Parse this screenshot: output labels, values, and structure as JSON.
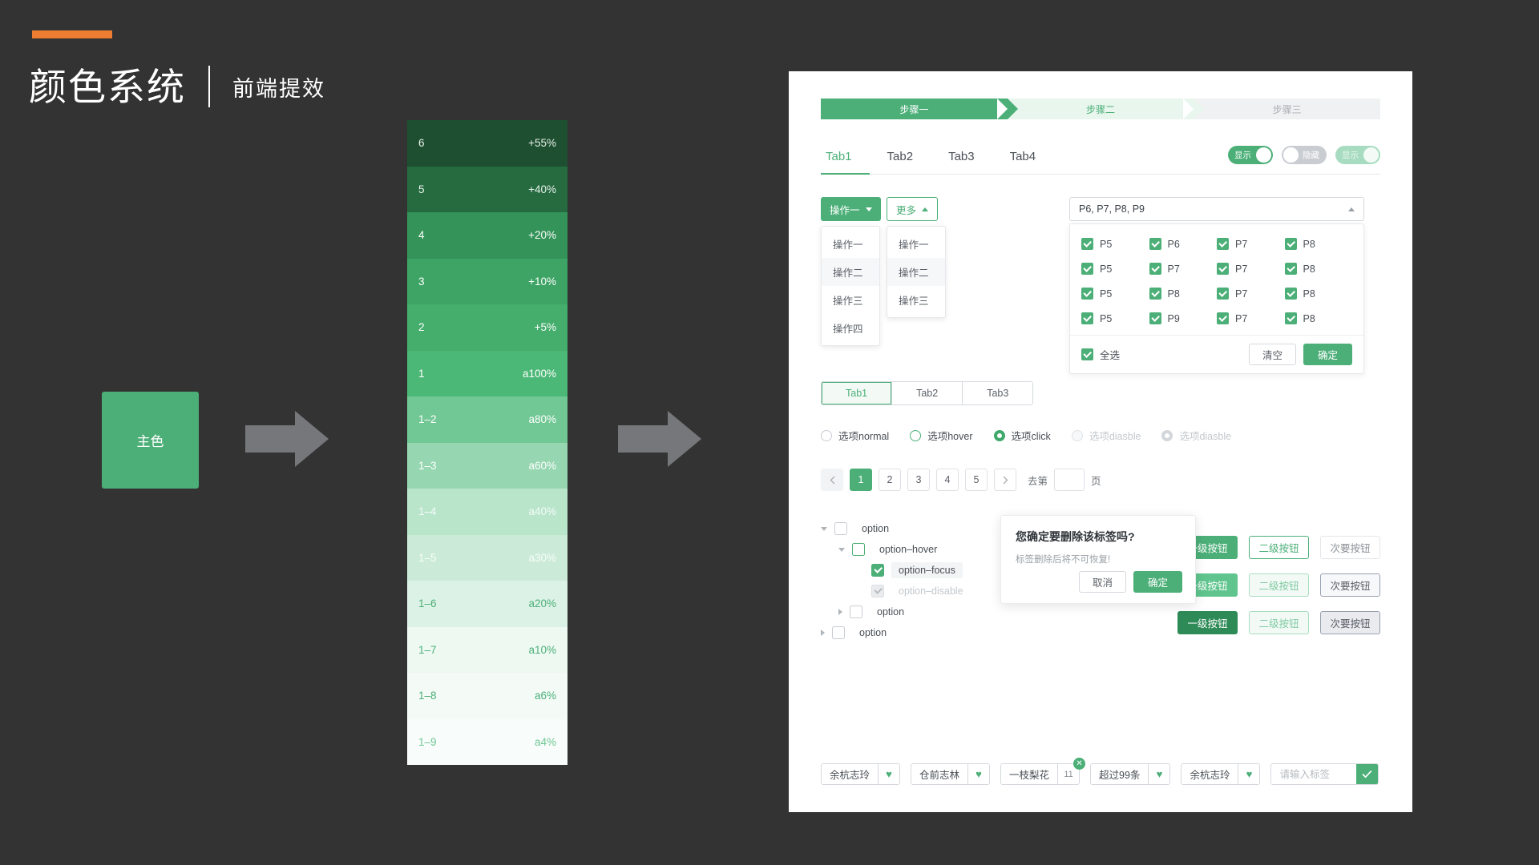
{
  "header": {
    "title": "颜色系统",
    "subtitle": "前端提效",
    "accent_color": "#ED7D31"
  },
  "main_color_block": {
    "label": "主色",
    "color": "#4CAF78"
  },
  "arrows": {
    "color": "#76777A",
    "count": 2
  },
  "palette": [
    {
      "step": "6",
      "value": "+55%",
      "color": "#1D4F30",
      "text": "#E8F0EA"
    },
    {
      "step": "5",
      "value": "+40%",
      "color": "#266B40",
      "text": "#E8F2EC"
    },
    {
      "step": "4",
      "value": "+20%",
      "color": "#349359",
      "text": "#FFFFFF"
    },
    {
      "step": "3",
      "value": "+10%",
      "color": "#3DA465",
      "text": "#FFFFFF"
    },
    {
      "step": "2",
      "value": "+5%",
      "color": "#45AE6D",
      "text": "#FFFFFF"
    },
    {
      "step": "1",
      "value": "a100%",
      "color": "#4CB877",
      "text": "#FFFFFF"
    },
    {
      "step": "1–2",
      "value": "a80%",
      "color": "#71C894",
      "text": "#FFFFFF"
    },
    {
      "step": "1–3",
      "value": "a60%",
      "color": "#96D7B1",
      "text": "#FFFFFF"
    },
    {
      "step": "1–4",
      "value": "a40%",
      "color": "#B9E5CB",
      "text": "#F4FBF7"
    },
    {
      "step": "1–5",
      "value": "a30%",
      "color": "#CBEBD8",
      "text": "#F7FCF9"
    },
    {
      "step": "1–6",
      "value": "a20%",
      "color": "#DDF2E6",
      "text": "#4CAF78"
    },
    {
      "step": "1–7",
      "value": "a10%",
      "color": "#EEF9F2",
      "text": "#4CAF78"
    },
    {
      "step": "1–8",
      "value": "a6%",
      "color": "#F4FBF7",
      "text": "#4CAF78"
    },
    {
      "step": "1–9",
      "value": "a4%",
      "color": "#F8FCFA",
      "text": "#6FC795"
    }
  ],
  "demo": {
    "steps": [
      {
        "label": "步骤一",
        "state": "active"
      },
      {
        "label": "步骤二",
        "state": "next"
      },
      {
        "label": "步骤三",
        "state": "todo"
      }
    ],
    "tabs_underline": [
      {
        "label": "Tab1",
        "active": true
      },
      {
        "label": "Tab2",
        "active": false
      },
      {
        "label": "Tab3",
        "active": false
      },
      {
        "label": "Tab4",
        "active": false
      }
    ],
    "toggles": [
      {
        "label": "显示",
        "state": "on"
      },
      {
        "label": "隐藏",
        "state": "off"
      },
      {
        "label": "显示",
        "state": "disabled"
      }
    ],
    "dropdown_primary": {
      "label": "操作一",
      "caret": "chevron-down-icon",
      "items": [
        {
          "label": "操作一",
          "highlight": false
        },
        {
          "label": "操作二",
          "highlight": true
        },
        {
          "label": "操作三",
          "highlight": false
        },
        {
          "label": "操作四",
          "highlight": false
        }
      ]
    },
    "dropdown_ghost": {
      "label": "更多",
      "caret": "chevron-up-icon",
      "items": [
        {
          "label": "操作一",
          "highlight": false
        },
        {
          "label": "操作二",
          "highlight": true
        },
        {
          "label": "操作三",
          "highlight": false
        }
      ]
    },
    "multiselect": {
      "value": "P6, P7, P8, P9",
      "caret": "chevron-up-icon",
      "options": [
        {
          "label": "P5",
          "checked": true
        },
        {
          "label": "P6",
          "checked": true
        },
        {
          "label": "P7",
          "checked": true
        },
        {
          "label": "P8",
          "checked": true
        },
        {
          "label": "P5",
          "checked": true
        },
        {
          "label": "P7",
          "checked": true
        },
        {
          "label": "P7",
          "checked": true
        },
        {
          "label": "P8",
          "checked": true
        },
        {
          "label": "P5",
          "checked": true
        },
        {
          "label": "P8",
          "checked": true
        },
        {
          "label": "P7",
          "checked": true
        },
        {
          "label": "P8",
          "checked": true
        },
        {
          "label": "P5",
          "checked": true
        },
        {
          "label": "P9",
          "checked": true
        },
        {
          "label": "P7",
          "checked": true
        },
        {
          "label": "P8",
          "checked": true
        }
      ],
      "select_all_label": "全选",
      "select_all_checked": true,
      "clear_label": "清空",
      "confirm_label": "确定"
    },
    "segmented_tabs": [
      {
        "label": "Tab1",
        "active": true
      },
      {
        "label": "Tab2",
        "active": false
      },
      {
        "label": "Tab3",
        "active": false
      }
    ],
    "radios": [
      {
        "label": "选项normal",
        "state": "normal"
      },
      {
        "label": "选项hover",
        "state": "hover"
      },
      {
        "label": "选项click",
        "state": "click"
      },
      {
        "label": "选项diasble",
        "state": "disabled"
      },
      {
        "label": "选项diasble",
        "state": "disabled-checked"
      }
    ],
    "pagination": {
      "prev_icon": "chevron-left-icon",
      "next_icon": "chevron-right-icon",
      "pages": [
        "1",
        "2",
        "3",
        "4",
        "5"
      ],
      "current": "1",
      "goto_label": "去第",
      "goto_value": "",
      "page_unit": "页"
    },
    "tree": [
      {
        "label": "option",
        "indent": 0,
        "twisty": "down",
        "check": "empty",
        "style": "normal",
        "depth": 0
      },
      {
        "label": "option–hover",
        "indent": 1,
        "twisty": "down",
        "check": "empty-green",
        "style": "normal",
        "depth": 1
      },
      {
        "label": "option–focus",
        "indent": 2,
        "twisty": "blank",
        "check": "checked",
        "style": "focus",
        "depth": 2
      },
      {
        "label": "option–disable",
        "indent": 2,
        "twisty": "blank",
        "check": "dis",
        "style": "disabled",
        "depth": 2
      },
      {
        "label": "option",
        "indent": 1,
        "twisty": "right",
        "check": "empty",
        "style": "normal",
        "depth": 1
      },
      {
        "label": "option",
        "indent": 0,
        "twisty": "right",
        "check": "empty",
        "style": "normal",
        "depth": 0
      }
    ],
    "buttons": [
      {
        "label": "一级按钮",
        "variant": "p1"
      },
      {
        "label": "二级按钮",
        "variant": "s1"
      },
      {
        "label": "次要按钮",
        "variant": "t1"
      },
      {
        "label": "一级按钮",
        "variant": "p2"
      },
      {
        "label": "二级按钮",
        "variant": "s2"
      },
      {
        "label": "次要按钮",
        "variant": "t2"
      },
      {
        "label": "一级按钮",
        "variant": "p3"
      },
      {
        "label": "二级按钮",
        "variant": "s3"
      },
      {
        "label": "次要按钮",
        "variant": "t3"
      }
    ],
    "dialog": {
      "title": "您确定要删除该标签吗?",
      "message": "标签删除后将不可恢复!",
      "cancel_label": "取消",
      "confirm_label": "确定"
    },
    "tags": [
      {
        "text": "余杭志玲",
        "side": "heart",
        "num": "",
        "closable": false
      },
      {
        "text": "仓前志林",
        "side": "heart",
        "num": "",
        "closable": false
      },
      {
        "text": "一枝梨花",
        "side": "num",
        "num": "11",
        "closable": true
      },
      {
        "text": "超过99条",
        "side": "heart",
        "num": "",
        "closable": false
      },
      {
        "text": "余杭志玲",
        "side": "heart",
        "num": "",
        "closable": false
      }
    ],
    "tag_input": {
      "placeholder": "请输入标签",
      "value": "",
      "confirm_icon": "check-icon"
    }
  }
}
